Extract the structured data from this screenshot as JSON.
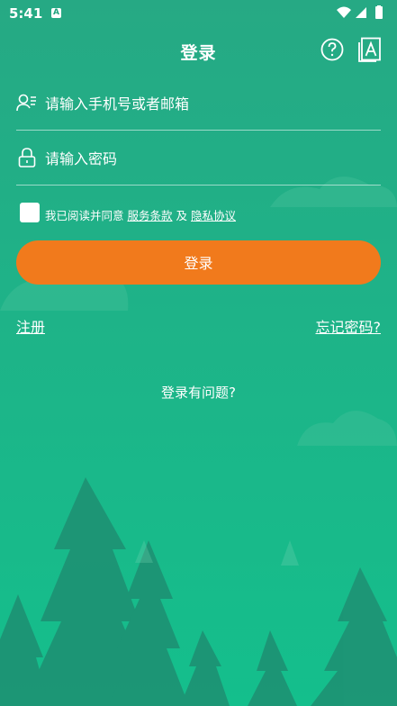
{
  "status_bar": {
    "time": "5:41",
    "notification_badge": "A"
  },
  "header": {
    "title": "登录",
    "help_icon": "question-circle-icon",
    "font_icon": "font-size-icon"
  },
  "form": {
    "account_placeholder": "请输入手机号或者邮箱",
    "account_value": "",
    "password_placeholder": "请输入密码",
    "password_value": ""
  },
  "agreement": {
    "checked": false,
    "prefix": "我已阅读并同意",
    "terms_link": "服务条款",
    "conjunction": "及",
    "privacy_link": "隐私协议"
  },
  "login_button": {
    "label": "登录"
  },
  "links": {
    "register": "注册",
    "forgot_password": "忘记密码?",
    "trouble": "登录有问题?"
  },
  "colors": {
    "background": "#1eb388",
    "accent_button": "#f17a1c",
    "text": "#ffffff"
  }
}
